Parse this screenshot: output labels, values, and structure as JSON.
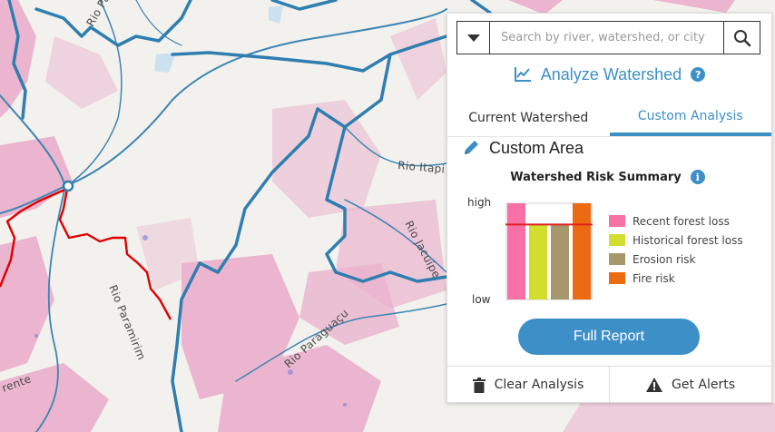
{
  "map": {
    "river_labels": [
      "Rio Pa",
      "Rio Itapi",
      "Rio Jacuípe",
      "Rio Paramirim",
      "Rio Paraguaçu",
      "rente"
    ],
    "colors": {
      "background": "#f2f1ed",
      "forest_loss": "#e8a0c4",
      "water": "#3c85b3",
      "watershed_outline": "#e00000"
    }
  },
  "panel": {
    "search": {
      "placeholder": "Search by river, watershed, or city"
    },
    "analyze": {
      "title": "Analyze Watershed",
      "help": "?"
    },
    "tabs": [
      {
        "label": "Current Watershed",
        "active": false
      },
      {
        "label": "Custom Analysis",
        "active": true
      }
    ],
    "custom_area": {
      "title": "Custom Area"
    },
    "risk": {
      "title": "Watershed Risk Summary",
      "info": "i"
    },
    "buttons": {
      "full_report": "Full Report",
      "clear": "Clear Analysis",
      "alerts": "Get Alerts"
    }
  },
  "chart_data": {
    "type": "bar",
    "title": "Watershed Risk Summary",
    "ylabels": {
      "high": "high",
      "low": "low"
    },
    "ylim": [
      0,
      1
    ],
    "threshold": 0.78,
    "threshold_color": "#e02020",
    "categories": [
      "Recent forest loss",
      "Historical forest loss",
      "Erosion risk",
      "Fire risk"
    ],
    "values": [
      1.0,
      0.78,
      0.78,
      1.0
    ],
    "colors": [
      "#f771a6",
      "#d2dd2e",
      "#a6986b",
      "#ec6a12"
    ]
  }
}
